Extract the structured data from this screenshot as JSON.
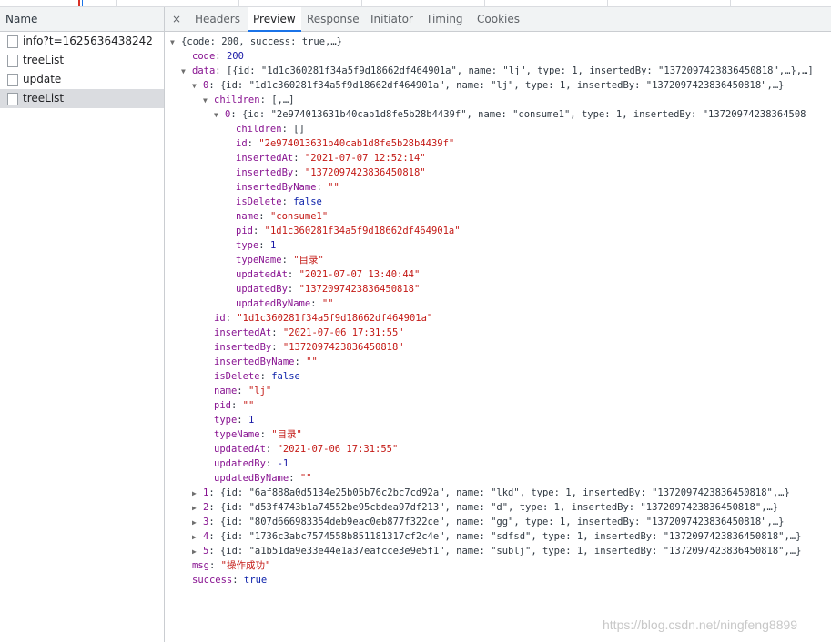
{
  "left_panel": {
    "header": "Name",
    "requests": [
      "info?t=1625636438242",
      "treeList",
      "update",
      "treeList"
    ],
    "selected_index": 3
  },
  "tabs": {
    "close": "×",
    "items": [
      "Headers",
      "Preview",
      "Response",
      "Initiator",
      "Timing",
      "Cookies"
    ],
    "active_index": 1
  },
  "preview": {
    "lines": [
      {
        "d": 0,
        "t": "open",
        "parts": [
          [
            "p",
            "{code: 200, success: true,…}"
          ]
        ]
      },
      {
        "d": 1,
        "t": "leaf",
        "parts": [
          [
            "k",
            "code"
          ],
          [
            "p",
            ": "
          ],
          [
            "n",
            "200"
          ]
        ]
      },
      {
        "d": 1,
        "t": "open",
        "parts": [
          [
            "k",
            "data"
          ],
          [
            "p",
            ": [{id: \"1d1c360281f34a5f9d18662df464901a\", name: \"lj\", type: 1, insertedBy: \"1372097423836450818\",…},…]"
          ]
        ]
      },
      {
        "d": 2,
        "t": "open",
        "parts": [
          [
            "k",
            "0"
          ],
          [
            "p",
            ": {id: \"1d1c360281f34a5f9d18662df464901a\", name: \"lj\", type: 1, insertedBy: \"1372097423836450818\",…}"
          ]
        ]
      },
      {
        "d": 3,
        "t": "open",
        "parts": [
          [
            "k",
            "children"
          ],
          [
            "p",
            ": [,…]"
          ]
        ]
      },
      {
        "d": 4,
        "t": "open",
        "parts": [
          [
            "k",
            "0"
          ],
          [
            "p",
            ": {id: \"2e974013631b40cab1d8fe5b28b4439f\", name: \"consume1\", type: 1, insertedBy: \"13720974238364508"
          ]
        ]
      },
      {
        "d": 5,
        "t": "leaf",
        "parts": [
          [
            "k",
            "children"
          ],
          [
            "p",
            ": []"
          ]
        ]
      },
      {
        "d": 5,
        "t": "leaf",
        "parts": [
          [
            "k",
            "id"
          ],
          [
            "p",
            ": "
          ],
          [
            "s",
            "\"2e974013631b40cab1d8fe5b28b4439f\""
          ]
        ]
      },
      {
        "d": 5,
        "t": "leaf",
        "parts": [
          [
            "k",
            "insertedAt"
          ],
          [
            "p",
            ": "
          ],
          [
            "s",
            "\"2021-07-07 12:52:14\""
          ]
        ]
      },
      {
        "d": 5,
        "t": "leaf",
        "parts": [
          [
            "k",
            "insertedBy"
          ],
          [
            "p",
            ": "
          ],
          [
            "s",
            "\"1372097423836450818\""
          ]
        ]
      },
      {
        "d": 5,
        "t": "leaf",
        "parts": [
          [
            "k",
            "insertedByName"
          ],
          [
            "p",
            ": "
          ],
          [
            "s",
            "\"\""
          ]
        ]
      },
      {
        "d": 5,
        "t": "leaf",
        "parts": [
          [
            "k",
            "isDelete"
          ],
          [
            "p",
            ": "
          ],
          [
            "b",
            "false"
          ]
        ]
      },
      {
        "d": 5,
        "t": "leaf",
        "parts": [
          [
            "k",
            "name"
          ],
          [
            "p",
            ": "
          ],
          [
            "s",
            "\"consume1\""
          ]
        ]
      },
      {
        "d": 5,
        "t": "leaf",
        "parts": [
          [
            "k",
            "pid"
          ],
          [
            "p",
            ": "
          ],
          [
            "s",
            "\"1d1c360281f34a5f9d18662df464901a\""
          ]
        ]
      },
      {
        "d": 5,
        "t": "leaf",
        "parts": [
          [
            "k",
            "type"
          ],
          [
            "p",
            ": "
          ],
          [
            "n",
            "1"
          ]
        ]
      },
      {
        "d": 5,
        "t": "leaf",
        "parts": [
          [
            "k",
            "typeName"
          ],
          [
            "p",
            ": "
          ],
          [
            "s",
            "\"目录\""
          ]
        ]
      },
      {
        "d": 5,
        "t": "leaf",
        "parts": [
          [
            "k",
            "updatedAt"
          ],
          [
            "p",
            ": "
          ],
          [
            "s",
            "\"2021-07-07 13:40:44\""
          ]
        ]
      },
      {
        "d": 5,
        "t": "leaf",
        "parts": [
          [
            "k",
            "updatedBy"
          ],
          [
            "p",
            ": "
          ],
          [
            "s",
            "\"1372097423836450818\""
          ]
        ]
      },
      {
        "d": 5,
        "t": "leaf",
        "parts": [
          [
            "k",
            "updatedByName"
          ],
          [
            "p",
            ": "
          ],
          [
            "s",
            "\"\""
          ]
        ]
      },
      {
        "d": 3,
        "t": "leaf",
        "parts": [
          [
            "k",
            "id"
          ],
          [
            "p",
            ": "
          ],
          [
            "s",
            "\"1d1c360281f34a5f9d18662df464901a\""
          ]
        ]
      },
      {
        "d": 3,
        "t": "leaf",
        "parts": [
          [
            "k",
            "insertedAt"
          ],
          [
            "p",
            ": "
          ],
          [
            "s",
            "\"2021-07-06 17:31:55\""
          ]
        ]
      },
      {
        "d": 3,
        "t": "leaf",
        "parts": [
          [
            "k",
            "insertedBy"
          ],
          [
            "p",
            ": "
          ],
          [
            "s",
            "\"1372097423836450818\""
          ]
        ]
      },
      {
        "d": 3,
        "t": "leaf",
        "parts": [
          [
            "k",
            "insertedByName"
          ],
          [
            "p",
            ": "
          ],
          [
            "s",
            "\"\""
          ]
        ]
      },
      {
        "d": 3,
        "t": "leaf",
        "parts": [
          [
            "k",
            "isDelete"
          ],
          [
            "p",
            ": "
          ],
          [
            "b",
            "false"
          ]
        ]
      },
      {
        "d": 3,
        "t": "leaf",
        "parts": [
          [
            "k",
            "name"
          ],
          [
            "p",
            ": "
          ],
          [
            "s",
            "\"lj\""
          ]
        ]
      },
      {
        "d": 3,
        "t": "leaf",
        "parts": [
          [
            "k",
            "pid"
          ],
          [
            "p",
            ": "
          ],
          [
            "s",
            "\"\""
          ]
        ]
      },
      {
        "d": 3,
        "t": "leaf",
        "parts": [
          [
            "k",
            "type"
          ],
          [
            "p",
            ": "
          ],
          [
            "n",
            "1"
          ]
        ]
      },
      {
        "d": 3,
        "t": "leaf",
        "parts": [
          [
            "k",
            "typeName"
          ],
          [
            "p",
            ": "
          ],
          [
            "s",
            "\"目录\""
          ]
        ]
      },
      {
        "d": 3,
        "t": "leaf",
        "parts": [
          [
            "k",
            "updatedAt"
          ],
          [
            "p",
            ": "
          ],
          [
            "s",
            "\"2021-07-06 17:31:55\""
          ]
        ]
      },
      {
        "d": 3,
        "t": "leaf",
        "parts": [
          [
            "k",
            "updatedBy"
          ],
          [
            "p",
            ": "
          ],
          [
            "n",
            "-1"
          ]
        ]
      },
      {
        "d": 3,
        "t": "leaf",
        "parts": [
          [
            "k",
            "updatedByName"
          ],
          [
            "p",
            ": "
          ],
          [
            "s",
            "\"\""
          ]
        ]
      },
      {
        "d": 2,
        "t": "closed",
        "parts": [
          [
            "k",
            "1"
          ],
          [
            "p",
            ": {id: \"6af888a0d5134e25b05b76c2bc7cd92a\", name: \"lkd\", type: 1, insertedBy: \"1372097423836450818\",…}"
          ]
        ]
      },
      {
        "d": 2,
        "t": "closed",
        "parts": [
          [
            "k",
            "2"
          ],
          [
            "p",
            ": {id: \"d53f4743b1a74552be95cbdea97df213\", name: \"d\", type: 1, insertedBy: \"1372097423836450818\",…}"
          ]
        ]
      },
      {
        "d": 2,
        "t": "closed",
        "parts": [
          [
            "k",
            "3"
          ],
          [
            "p",
            ": {id: \"807d666983354deb9eac0eb877f322ce\", name: \"gg\", type: 1, insertedBy: \"1372097423836450818\",…}"
          ]
        ]
      },
      {
        "d": 2,
        "t": "closed",
        "parts": [
          [
            "k",
            "4"
          ],
          [
            "p",
            ": {id: \"1736c3abc7574558b851181317cf2c4e\", name: \"sdfsd\", type: 1, insertedBy: \"1372097423836450818\",…}"
          ]
        ]
      },
      {
        "d": 2,
        "t": "closed",
        "parts": [
          [
            "k",
            "5"
          ],
          [
            "p",
            ": {id: \"a1b51da9e33e44e1a37eafcce3e9e5f1\", name: \"sublj\", type: 1, insertedBy: \"1372097423836450818\",…}"
          ]
        ]
      },
      {
        "d": 1,
        "t": "leaf",
        "parts": [
          [
            "k",
            "msg"
          ],
          [
            "p",
            ": "
          ],
          [
            "s",
            "\"操作成功\""
          ]
        ]
      },
      {
        "d": 1,
        "t": "leaf",
        "parts": [
          [
            "k",
            "success"
          ],
          [
            "p",
            ": "
          ],
          [
            "b",
            "true"
          ]
        ]
      }
    ]
  },
  "watermark": "https://blog.csdn.net/ningfeng8899"
}
